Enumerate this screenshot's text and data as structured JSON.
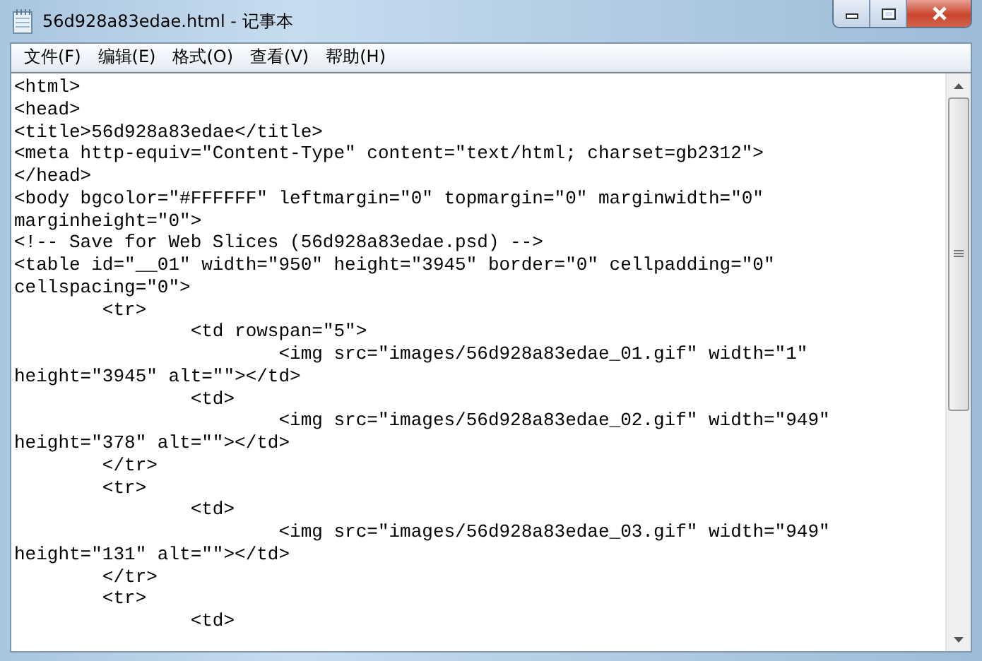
{
  "window": {
    "title": "56d928a83edae.html - 记事本"
  },
  "menu": [
    {
      "label": "文件(F)"
    },
    {
      "label": "编辑(E)"
    },
    {
      "label": "格式(O)"
    },
    {
      "label": "查看(V)"
    },
    {
      "label": "帮助(H)"
    }
  ],
  "editor": {
    "lines": [
      "<html>",
      "<head>",
      "<title>56d928a83edae</title>",
      "<meta http-equiv=\"Content-Type\" content=\"text/html; charset=gb2312\">",
      "</head>",
      "<body bgcolor=\"#FFFFFF\" leftmargin=\"0\" topmargin=\"0\" marginwidth=\"0\"",
      "marginheight=\"0\">",
      "<!-- Save for Web Slices (56d928a83edae.psd) -->",
      "<table id=\"__01\" width=\"950\" height=\"3945\" border=\"0\" cellpadding=\"0\"",
      "cellspacing=\"0\">",
      "\t<tr>",
      "\t\t<td rowspan=\"5\">",
      "\t\t\t<img src=\"images/56d928a83edae_01.gif\" width=\"1\"",
      "height=\"3945\" alt=\"\"></td>",
      "\t\t<td>",
      "\t\t\t<img src=\"images/56d928a83edae_02.gif\" width=\"949\"",
      "height=\"378\" alt=\"\"></td>",
      "\t</tr>",
      "\t<tr>",
      "\t\t<td>",
      "\t\t\t<img src=\"images/56d928a83edae_03.gif\" width=\"949\"",
      "height=\"131\" alt=\"\"></td>",
      "\t</tr>",
      "\t<tr>",
      "\t\t<td>"
    ]
  }
}
